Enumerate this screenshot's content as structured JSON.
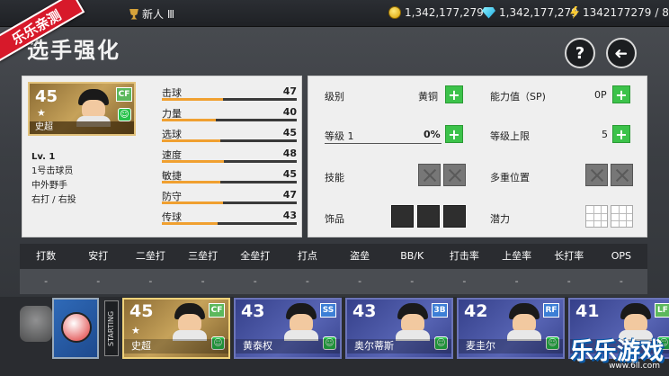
{
  "topbar": {
    "rank": "新人 Ⅲ",
    "coins": "1,342,177,279",
    "gems": "1,342,177,279",
    "energy": "1342177279",
    "energy_max": "/ 8"
  },
  "watermark": {
    "badge": "乐乐亲测",
    "brand": "乐乐游戏",
    "url": "www.6ll.com"
  },
  "page": {
    "title": "选手强化",
    "help_label": "?",
    "back_label": "➜"
  },
  "player": {
    "rating": "45",
    "position": "CF",
    "name": "史超",
    "level": "Lv. 1",
    "batting_order": "1号击球员",
    "field_position": "中外野手",
    "handedness": "右打 / 右投"
  },
  "stats": [
    {
      "label": "击球",
      "value": "47",
      "fill_fraction": 0.45
    },
    {
      "label": "力量",
      "value": "40",
      "fill_fraction": 0.4
    },
    {
      "label": "选球",
      "value": "45",
      "fill_fraction": 0.43
    },
    {
      "label": "速度",
      "value": "48",
      "fill_fraction": 0.46
    },
    {
      "label": "敏捷",
      "value": "45",
      "fill_fraction": 0.43
    },
    {
      "label": "防守",
      "value": "47",
      "fill_fraction": 0.45
    },
    {
      "label": "传球",
      "value": "43",
      "fill_fraction": 0.41
    }
  ],
  "upgrade": {
    "grade_label": "级别",
    "grade_value": "黄铜",
    "ability_label": "能力值（SP)",
    "ability_value": "0P",
    "level_label": "等级 1",
    "level_value": "0%",
    "level_cap_label": "等级上限",
    "level_cap_value": "5",
    "skill_label": "技能",
    "multi_pos_label": "多重位置",
    "accessory_label": "饰品",
    "potential_label": "潜力",
    "plus": "+"
  },
  "table": {
    "headers": [
      "打数",
      "安打",
      "二垒打",
      "三垒打",
      "全垒打",
      "打点",
      "盗垒",
      "BB/K",
      "打击率",
      "上垒率",
      "长打率",
      "OPS"
    ],
    "values": [
      "-",
      "-",
      "-",
      "-",
      "-",
      "-",
      "-",
      "-",
      "-",
      "-",
      "-",
      "-"
    ]
  },
  "lineup": {
    "starting_label": "STARTING",
    "cards": [
      {
        "rating": "45",
        "position": "CF",
        "name": "史超"
      },
      {
        "rating": "43",
        "position": "SS",
        "name": "黄泰权"
      },
      {
        "rating": "43",
        "position": "3B",
        "name": "奥尔蒂斯"
      },
      {
        "rating": "42",
        "position": "RF",
        "name": "麦圭尔"
      },
      {
        "rating": "41",
        "position": "LF",
        "name": ""
      }
    ]
  },
  "colors": {
    "plus_green": "#3cc24a",
    "bar_fill": "#f0a030",
    "gold_card": "#c6a25a",
    "blue_card": "#5865b5"
  }
}
